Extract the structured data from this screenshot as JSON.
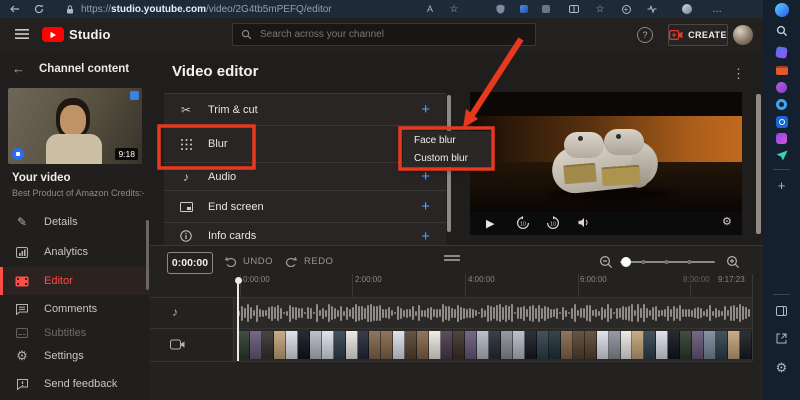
{
  "browser": {
    "url_scheme": "https://",
    "url_domain": "studio.youtube.com",
    "url_path": "/video/2G4tb5mPEFQ/editor"
  },
  "edge_sidebar": {
    "icons": [
      "copilot",
      "search",
      "shopping",
      "tools",
      "people",
      "loop",
      "outlook",
      "designer",
      "send",
      "add",
      "panel",
      "open-link",
      "settings"
    ]
  },
  "header": {
    "brand": "Studio",
    "search_placeholder": "Search across your channel",
    "help": "?",
    "create": "CREATE"
  },
  "sidebar": {
    "back_label": "Channel content",
    "video_title": "Your video",
    "video_subtitle": "Best Product of Amazon Credits:- A..",
    "duration": "9:18",
    "items": [
      {
        "label": "Details"
      },
      {
        "label": "Analytics"
      },
      {
        "label": "Editor"
      },
      {
        "label": "Comments"
      },
      {
        "label": "Subtitles"
      },
      {
        "label": "Settings"
      },
      {
        "label": "Send feedback"
      }
    ]
  },
  "editor": {
    "title": "Video editor",
    "options": [
      {
        "label": "Trim & cut"
      },
      {
        "label": "Blur"
      },
      {
        "label": "Audio"
      },
      {
        "label": "End screen"
      },
      {
        "label": "Info cards"
      }
    ],
    "blur_menu": [
      {
        "label": "Face blur"
      },
      {
        "label": "Custom blur"
      }
    ]
  },
  "timeline": {
    "timecode": "0:00:00",
    "undo": "UNDO",
    "redo": "REDO",
    "ruler": [
      "0:00:00",
      "2:00:00",
      "4:00:00",
      "6:00:00",
      "8:00:00",
      "9:17:23"
    ]
  },
  "icons": {
    "plus": "+",
    "kebab": "⋮",
    "back": "←",
    "gear": "⚙",
    "pencil": "✎",
    "scissors": "✂",
    "music_note": "♪",
    "play": "▶",
    "star": "☆",
    "ellipsis": "…",
    "reader": "A"
  },
  "colors": {
    "annotation_red": "#e8391f",
    "accent_blue": "#3ea6ff",
    "active_red": "#ff4e45",
    "brand_red": "#ff0302"
  }
}
